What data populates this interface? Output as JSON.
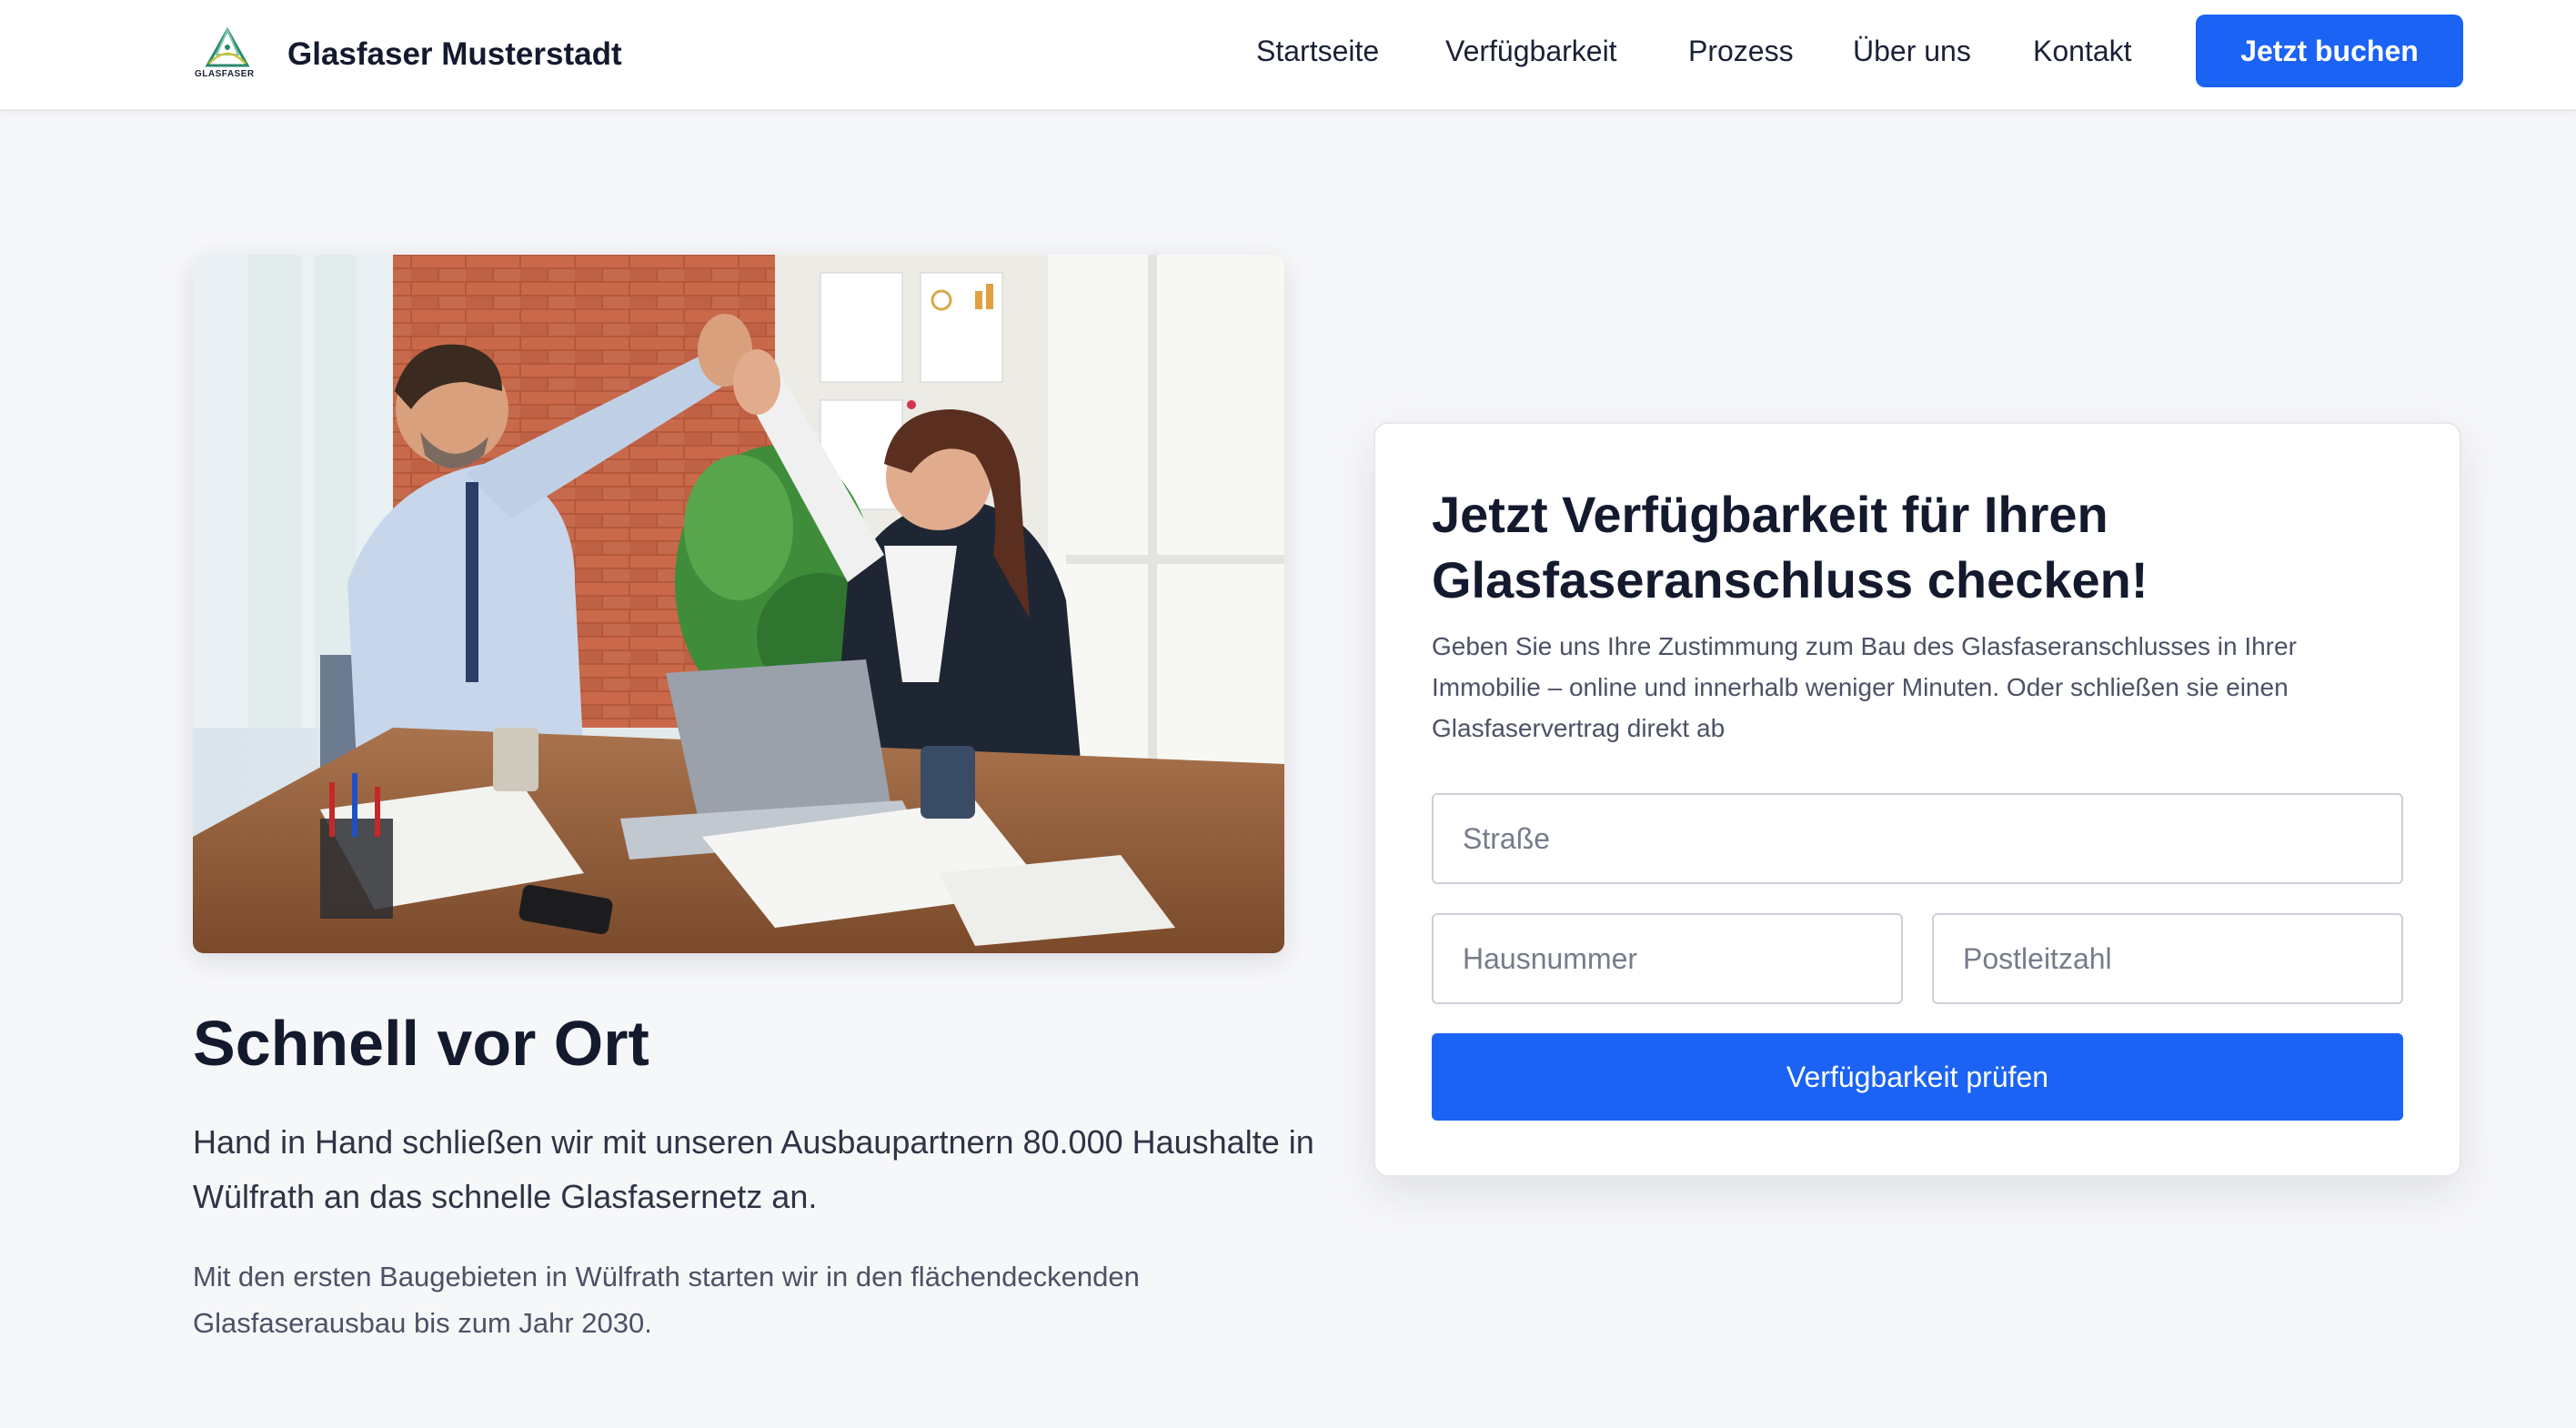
{
  "header": {
    "logo_text": "GLASFASER",
    "brand_name": "Glasfaser Musterstadt",
    "nav": [
      {
        "label": "Startseite"
      },
      {
        "label": "Verfügbarkeit"
      },
      {
        "label": "Prozess"
      },
      {
        "label": "Über uns"
      },
      {
        "label": "Kontakt"
      }
    ],
    "cta_label": "Jetzt buchen"
  },
  "hero": {
    "title": "Schnell vor Ort",
    "lead": "Hand in Hand schließen wir mit unseren Ausbaupartnern 80.000 Haushalte in Wülfrath an das schnelle Glasfasernetz an.",
    "text": "Mit den ersten Baugebieten in Wülfrath starten wir in den flächendeckenden Glasfaserausbau bis zum Jahr 2030."
  },
  "availability_form": {
    "title": "Jetzt Verfügbarkeit für Ihren Glasfaseranschluss checken!",
    "description": "Geben Sie uns Ihre Zustimmung zum Bau des Glasfaseranschlusses in Ihrer Immobilie – online und innerhalb weniger Minuten. Oder schließen sie einen Glasfaservertrag direkt ab",
    "street_placeholder": "Straße",
    "house_number_placeholder": "Hausnummer",
    "postal_code_placeholder": "Postleitzahl",
    "submit_label": "Verfügbarkeit prüfen"
  },
  "colors": {
    "primary": "#1a63f5",
    "background": "#f6f7f9",
    "heading": "#141a2e",
    "body_text": "#4b5265"
  }
}
